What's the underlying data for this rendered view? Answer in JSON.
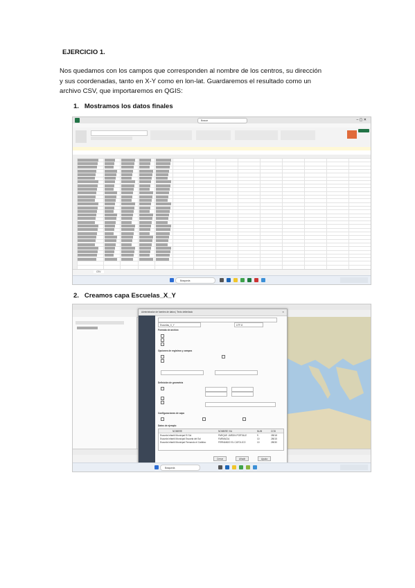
{
  "heading": "EJERCICIO 1.",
  "intro_line1": "Nos quedamos con los campos que corresponden al nombre de los centros, su dirección",
  "intro_line2": "y sus coordenadas, tanto en X-Y como en lon-lat. Guardaremos el resultado como un",
  "intro_line3": "archivo CSV, que importaremos en QGIS:",
  "steps": [
    {
      "number": "1.",
      "label": "Mostramos los datos finales"
    },
    {
      "number": "2.",
      "label": "Creamos capa Escuelas_X_Y"
    }
  ],
  "excel": {
    "search_placeholder": "Buscar",
    "sheet_tab": "CSV",
    "taskbar_search": "Búsqueda",
    "colors": {
      "ribbon": "#f3f3f3",
      "title": "#e6e6e6",
      "accent": "#217346"
    }
  },
  "qgis": {
    "dialog_title": "Administrador de fuentes de datos | Texto delimitado",
    "layer_name_value": "Escuelas_X_Y",
    "encoding_value": "UTF-8",
    "sections": [
      "Formato de archivo",
      "Opciones de registros y campos",
      "Definición de geometría",
      "Configuraciones de capa",
      "Datos de ejemplo"
    ],
    "sample_headers": [
      "NOMBRE",
      "NOMBRE VIA",
      "NUM",
      "COD"
    ],
    "sample_rows": [
      [
        "Escuela Infantil Municipal El Sol",
        "PARQUE JARDIN PORTALE",
        "9",
        "28018"
      ],
      [
        "Escuela Infantil Municipal Escuela del Sol",
        "FARMACIA",
        "10",
        "28015"
      ],
      [
        "Escuela Infantil Municipal Fernando el Católico",
        "FERNANDO EL CATOLICO",
        "10",
        "28030"
      ]
    ],
    "buttons": [
      "Cerrar",
      "Añadir",
      "Ayuda"
    ],
    "taskbar_search": "Búsqueda",
    "colors": {
      "sidebar": "#3b4656",
      "map_sea": "#a9c9e3",
      "map_land": "#d9d4b4"
    }
  }
}
